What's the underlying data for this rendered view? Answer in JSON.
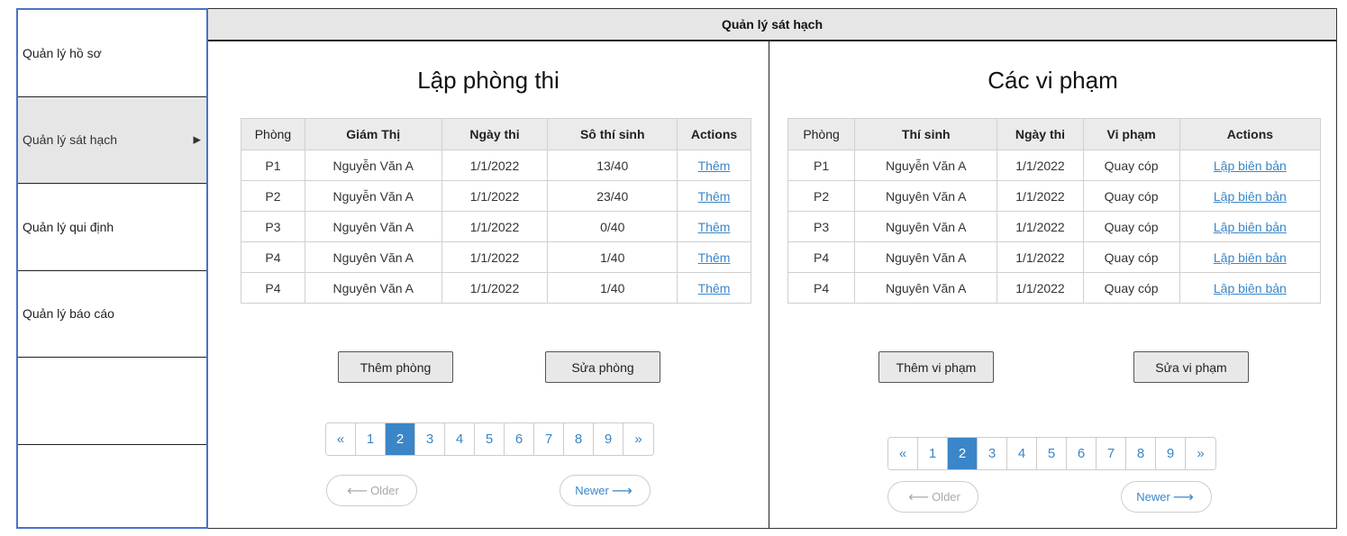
{
  "sidebar": {
    "items": [
      {
        "label": "Quản lý hồ sơ"
      },
      {
        "label": "Quản lý sát hạch"
      },
      {
        "label": "Quản lý qui định"
      },
      {
        "label": "Quản lý báo cáo"
      },
      {
        "label": ""
      },
      {
        "label": ""
      }
    ],
    "active_arrow": "▶"
  },
  "header": {
    "title": "Quản lý sát hạch"
  },
  "left_panel": {
    "title": "Lập phòng thi",
    "columns": [
      "Phòng",
      "Giám Thị",
      "Ngày thi",
      "Sô thí sinh",
      "Actions"
    ],
    "rows": [
      {
        "room": "P1",
        "supervisor": "Nguyễn Văn A",
        "date": "1/1/2022",
        "count": "13/40",
        "action": "Thêm"
      },
      {
        "room": "P2",
        "supervisor": "Nguyễn Văn A",
        "date": "1/1/2022",
        "count": "23/40",
        "action": "Thêm"
      },
      {
        "room": "P3",
        "supervisor": "Nguyên Văn A",
        "date": "1/1/2022",
        "count": "0/40",
        "action": "Thêm"
      },
      {
        "room": "P4",
        "supervisor": "Nguyên Văn A",
        "date": "1/1/2022",
        "count": "1/40",
        "action": "Thêm"
      },
      {
        "room": "P4",
        "supervisor": "Nguyên Văn A",
        "date": "1/1/2022",
        "count": "1/40",
        "action": "Thêm"
      }
    ],
    "add_button": "Thêm phòng",
    "edit_button": "Sửa phòng",
    "pagination": [
      "«",
      "1",
      "2",
      "3",
      "4",
      "5",
      "6",
      "7",
      "8",
      "9",
      "»"
    ],
    "active_page": "2",
    "older_label": "Older",
    "newer_label": "Newer"
  },
  "right_panel": {
    "title": "Các vi phạm",
    "columns": [
      "Phòng",
      "Thí sinh",
      "Ngày thi",
      "Vi phạm",
      "Actions"
    ],
    "rows": [
      {
        "room": "P1",
        "candidate": "Nguyễn Văn A",
        "date": "1/1/2022",
        "violation": "Quay cóp",
        "action": "Lập biên bản"
      },
      {
        "room": "P2",
        "candidate": "Nguyên Văn A",
        "date": "1/1/2022",
        "violation": "Quay cóp",
        "action": "Lập biên bản"
      },
      {
        "room": "P3",
        "candidate": "Nguyên Văn A",
        "date": "1/1/2022",
        "violation": "Quay cóp",
        "action": "Lập biên bản"
      },
      {
        "room": "P4",
        "candidate": "Nguyên Văn A",
        "date": "1/1/2022",
        "violation": "Quay cóp",
        "action": "Lập biên bản"
      },
      {
        "room": "P4",
        "candidate": "Nguyên Văn A",
        "date": "1/1/2022",
        "violation": "Quay cóp",
        "action": "Lập biên bản"
      }
    ],
    "add_button": "Thêm vi phạm",
    "edit_button": "Sửa vi phạm",
    "pagination": [
      "«",
      "1",
      "2",
      "3",
      "4",
      "5",
      "6",
      "7",
      "8",
      "9",
      "»"
    ],
    "active_page": "2",
    "older_label": "Older",
    "newer_label": "Newer"
  },
  "colors": {
    "accent": "#3a86c8",
    "sidebar_border": "#4a72c7",
    "header_bg": "#e6e6e6"
  },
  "icons": {
    "older": "arrow-left-icon",
    "newer": "arrow-right-icon",
    "submenu": "triangle-right-icon"
  }
}
